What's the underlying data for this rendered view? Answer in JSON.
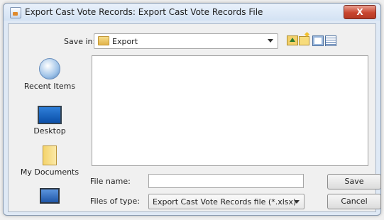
{
  "window": {
    "title": "Export Cast Vote Records: Export Cast Vote Records File",
    "close_label": "X"
  },
  "toolbar": {
    "save_in_label": "Save in:",
    "save_in_value": "Export",
    "buttons": [
      "up-folder-icon",
      "new-folder-icon",
      "list-view-icon",
      "details-view-icon"
    ]
  },
  "places": [
    {
      "label": "Recent Items",
      "icon": "recent-items-icon"
    },
    {
      "label": "Desktop",
      "icon": "desktop-icon"
    },
    {
      "label": "My Documents",
      "icon": "documents-icon"
    },
    {
      "label": "",
      "icon": "computer-icon"
    }
  ],
  "form": {
    "file_name_label": "File name:",
    "file_name_value": "",
    "files_of_type_label": "Files of type:",
    "files_of_type_value": "Export Cast Vote Records file (*.xlsx)"
  },
  "buttons": {
    "save": "Save",
    "cancel": "Cancel"
  }
}
